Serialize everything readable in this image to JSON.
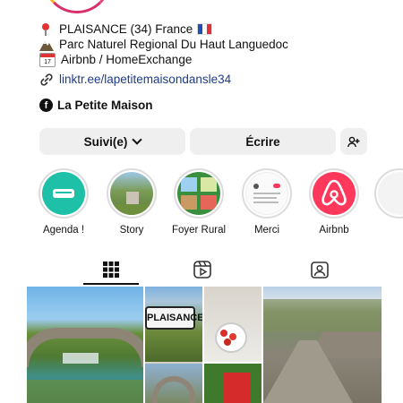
{
  "bio": {
    "location": "PLAISANCE (34) France",
    "park": "Parc Naturel Regional Du Haut Languedoc",
    "rentals": "Airbnb / HomeExchange",
    "link": "linktr.ee/lapetitemaisondansle34",
    "facebook": "La Petite Maison"
  },
  "actions": {
    "follow_label": "Suivi(e)",
    "message_label": "Écrire"
  },
  "highlights": [
    {
      "label": "Agenda !",
      "icon": "agenda-cover"
    },
    {
      "label": "Story",
      "icon": "story-cover"
    },
    {
      "label": "Foyer Rural",
      "icon": "foyer-rural-cover"
    },
    {
      "label": "Merci",
      "icon": "merci-cover"
    },
    {
      "label": "Airbnb",
      "icon": "airbnb-logo"
    }
  ],
  "tabs": [
    {
      "name": "grid-icon",
      "active": true
    },
    {
      "name": "reels-icon",
      "active": false
    },
    {
      "name": "tagged-icon",
      "active": false
    }
  ],
  "grid": {
    "sign_text": "PLAISANCE"
  },
  "colors": {
    "link": "#1f3b8a",
    "button_bg": "#efefef",
    "airbnb": "#ff385c",
    "agenda": "#1ec0a8"
  }
}
